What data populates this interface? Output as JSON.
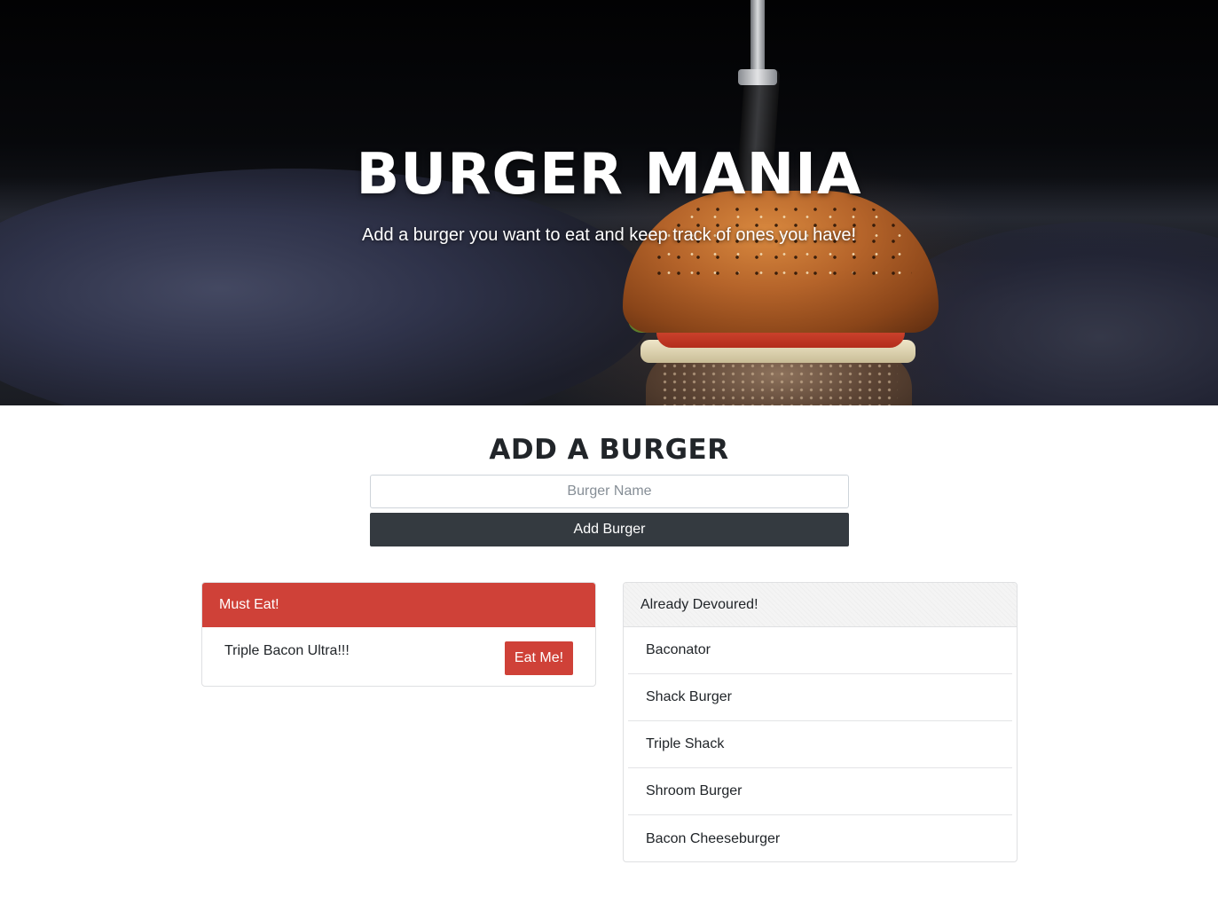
{
  "hero": {
    "title": "BURGER MANIA",
    "subtitle": "Add a burger you want to eat and keep track of ones you have!"
  },
  "add_form": {
    "heading": "ADD A BURGER",
    "input_placeholder": "Burger Name",
    "input_value": "",
    "button_label": "Add Burger"
  },
  "must_eat": {
    "header": "Must Eat!",
    "items": [
      {
        "name": "Triple Bacon Ultra!!!",
        "button_label": "Eat Me!"
      }
    ]
  },
  "devoured": {
    "header": "Already Devoured!",
    "items": [
      {
        "name": "Baconator"
      },
      {
        "name": "Shack Burger"
      },
      {
        "name": "Triple Shack"
      },
      {
        "name": "Shroom Burger"
      },
      {
        "name": "Bacon Cheeseburger"
      }
    ]
  },
  "colors": {
    "accent_red": "#cf4138",
    "button_dark": "#343a40"
  }
}
